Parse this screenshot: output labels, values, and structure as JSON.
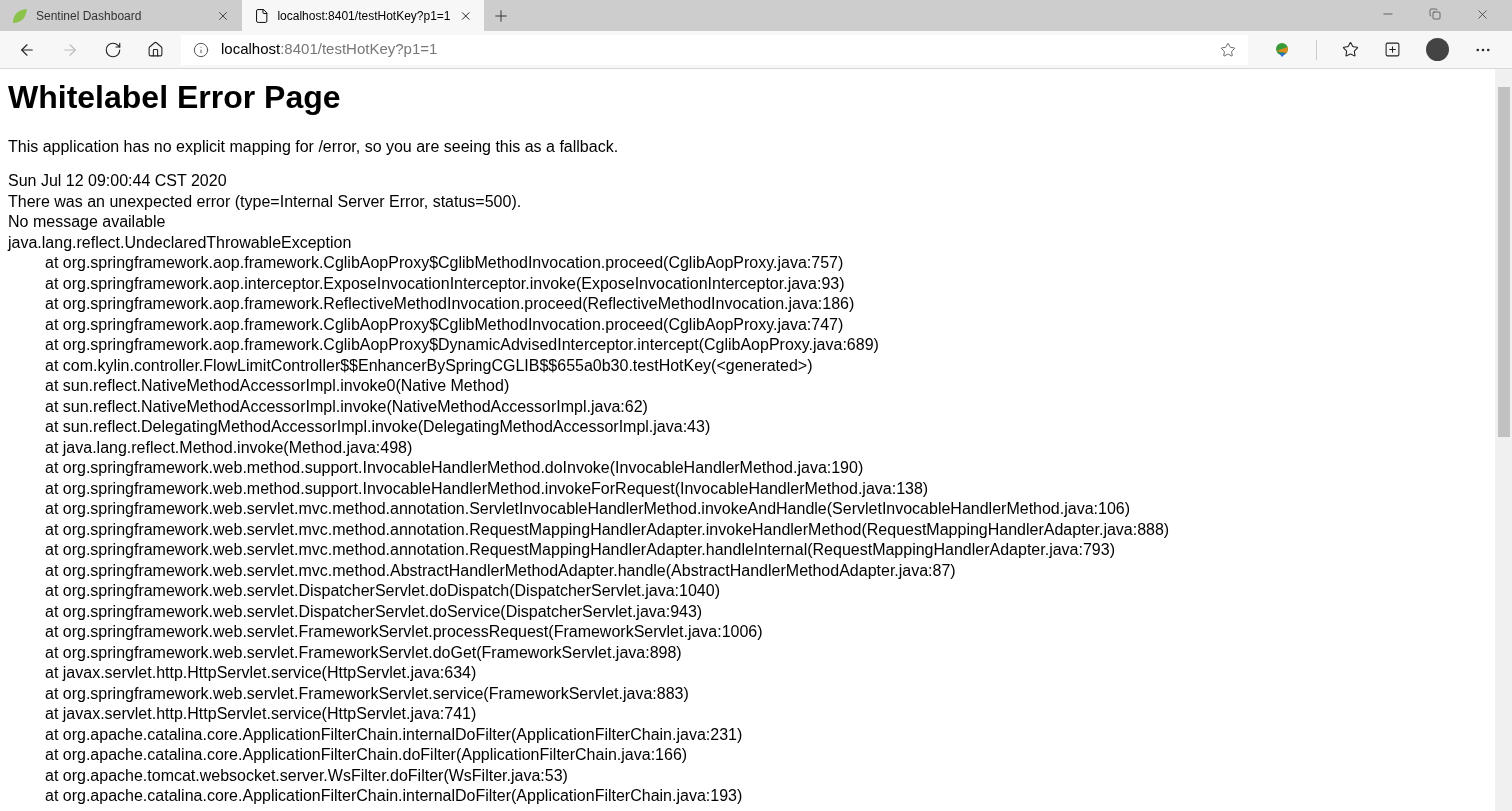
{
  "browser": {
    "tabs": [
      {
        "title": "Sentinel Dashboard",
        "kind": "site",
        "selected": false
      },
      {
        "title": "localhost:8401/testHotKey?p1=1",
        "kind": "blank",
        "selected": true
      }
    ],
    "address": {
      "host": "localhost",
      "rest": ":8401/testHotKey?p1=1"
    }
  },
  "page": {
    "heading": "Whitelabel Error Page",
    "intro": "This application has no explicit mapping for /error, so you are seeing this as a fallback.",
    "lines": [
      "Sun Jul 12 09:00:44 CST 2020",
      "There was an unexpected error (type=Internal Server Error, status=500).",
      "No message available",
      "java.lang.reflect.UndeclaredThrowableException"
    ],
    "frames": [
      "at org.springframework.aop.framework.CglibAopProxy$CglibMethodInvocation.proceed(CglibAopProxy.java:757)",
      "at org.springframework.aop.interceptor.ExposeInvocationInterceptor.invoke(ExposeInvocationInterceptor.java:93)",
      "at org.springframework.aop.framework.ReflectiveMethodInvocation.proceed(ReflectiveMethodInvocation.java:186)",
      "at org.springframework.aop.framework.CglibAopProxy$CglibMethodInvocation.proceed(CglibAopProxy.java:747)",
      "at org.springframework.aop.framework.CglibAopProxy$DynamicAdvisedInterceptor.intercept(CglibAopProxy.java:689)",
      "at com.kylin.controller.FlowLimitController$$EnhancerBySpringCGLIB$$655a0b30.testHotKey(<generated>)",
      "at sun.reflect.NativeMethodAccessorImpl.invoke0(Native Method)",
      "at sun.reflect.NativeMethodAccessorImpl.invoke(NativeMethodAccessorImpl.java:62)",
      "at sun.reflect.DelegatingMethodAccessorImpl.invoke(DelegatingMethodAccessorImpl.java:43)",
      "at java.lang.reflect.Method.invoke(Method.java:498)",
      "at org.springframework.web.method.support.InvocableHandlerMethod.doInvoke(InvocableHandlerMethod.java:190)",
      "at org.springframework.web.method.support.InvocableHandlerMethod.invokeForRequest(InvocableHandlerMethod.java:138)",
      "at org.springframework.web.servlet.mvc.method.annotation.ServletInvocableHandlerMethod.invokeAndHandle(ServletInvocableHandlerMethod.java:106)",
      "at org.springframework.web.servlet.mvc.method.annotation.RequestMappingHandlerAdapter.invokeHandlerMethod(RequestMappingHandlerAdapter.java:888)",
      "at org.springframework.web.servlet.mvc.method.annotation.RequestMappingHandlerAdapter.handleInternal(RequestMappingHandlerAdapter.java:793)",
      "at org.springframework.web.servlet.mvc.method.AbstractHandlerMethodAdapter.handle(AbstractHandlerMethodAdapter.java:87)",
      "at org.springframework.web.servlet.DispatcherServlet.doDispatch(DispatcherServlet.java:1040)",
      "at org.springframework.web.servlet.DispatcherServlet.doService(DispatcherServlet.java:943)",
      "at org.springframework.web.servlet.FrameworkServlet.processRequest(FrameworkServlet.java:1006)",
      "at org.springframework.web.servlet.FrameworkServlet.doGet(FrameworkServlet.java:898)",
      "at javax.servlet.http.HttpServlet.service(HttpServlet.java:634)",
      "at org.springframework.web.servlet.FrameworkServlet.service(FrameworkServlet.java:883)",
      "at javax.servlet.http.HttpServlet.service(HttpServlet.java:741)",
      "at org.apache.catalina.core.ApplicationFilterChain.internalDoFilter(ApplicationFilterChain.java:231)",
      "at org.apache.catalina.core.ApplicationFilterChain.doFilter(ApplicationFilterChain.java:166)",
      "at org.apache.tomcat.websocket.server.WsFilter.doFilter(WsFilter.java:53)",
      "at org.apache.catalina.core.ApplicationFilterChain.internalDoFilter(ApplicationFilterChain.java:193)"
    ]
  }
}
